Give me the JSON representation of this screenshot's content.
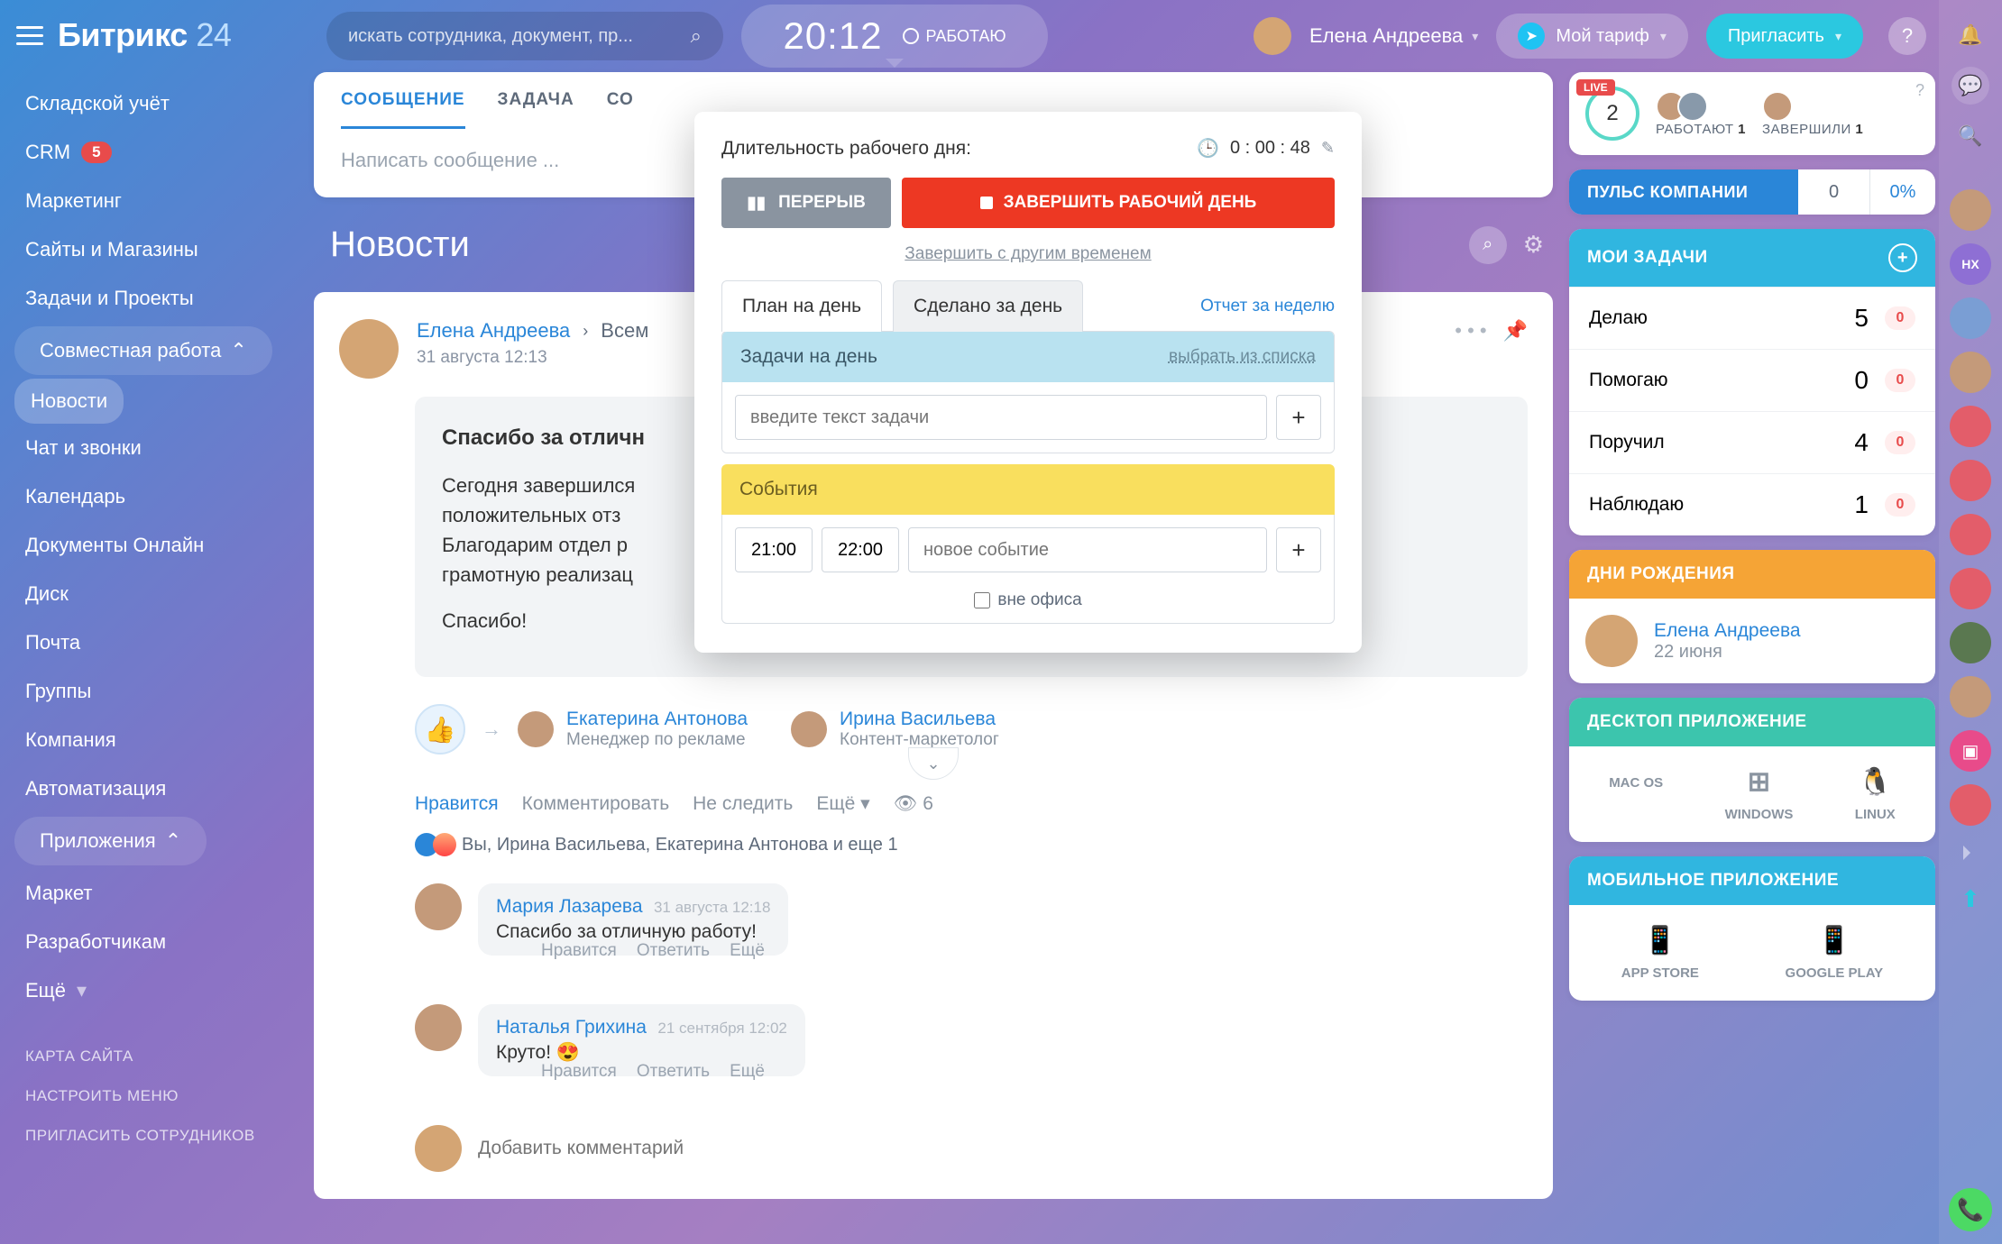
{
  "app": {
    "name": "Битрикс",
    "suffix": "24"
  },
  "topbar": {
    "search_placeholder": "искать сотрудника, документ, пр...",
    "clock": "20:12",
    "clock_status": "РАБОТАЮ",
    "user_name": "Елена Андреева",
    "tariff_label": "Мой тариф",
    "invite_label": "Пригласить",
    "help": "?"
  },
  "sidebar": {
    "items": [
      {
        "label": "Складской учёт"
      },
      {
        "label": "CRM",
        "badge": "5"
      },
      {
        "label": "Маркетинг"
      },
      {
        "label": "Сайты и Магазины"
      },
      {
        "label": "Задачи и Проекты"
      }
    ],
    "group_collab": "Совместная работа",
    "collab_items": [
      {
        "label": "Новости",
        "active": true
      },
      {
        "label": "Чат и звонки"
      },
      {
        "label": "Календарь"
      },
      {
        "label": "Документы Онлайн"
      },
      {
        "label": "Диск"
      },
      {
        "label": "Почта"
      },
      {
        "label": "Группы"
      }
    ],
    "items2": [
      {
        "label": "Компания"
      },
      {
        "label": "Автоматизация"
      }
    ],
    "group_apps": "Приложения",
    "app_items": [
      {
        "label": "Маркет"
      },
      {
        "label": "Разработчикам"
      }
    ],
    "more": "Ещё",
    "footer": [
      "КАРТА САЙТА",
      "НАСТРОИТЬ МЕНЮ",
      "ПРИГЛАСИТЬ СОТРУДНИКОВ"
    ]
  },
  "feed": {
    "tabs": [
      "СООБЩЕНИЕ",
      "ЗАДАЧА",
      "СО"
    ],
    "compose_placeholder": "Написать сообщение ...",
    "title": "Новости",
    "post": {
      "author": "Елена Андреева",
      "audience": "Всем",
      "date": "31 августа 12:13",
      "heading": "Спасибо за отличн",
      "p1": "Сегодня завершился",
      "p2": "положительных отз",
      "p3": "Благодарим отдел р",
      "p4": "грамотную реализац",
      "p5": "Спасибо!",
      "mentions": [
        {
          "name": "Екатерина Антонова",
          "role": "Менеджер по рекламе"
        },
        {
          "name": "Ирина Васильева",
          "role": "Контент-маркетолог"
        }
      ],
      "actions": {
        "like": "Нравится",
        "comment": "Комментировать",
        "unfollow": "Не следить",
        "more": "Ещё",
        "views": "6"
      },
      "reactions_text": "Вы, Ирина Васильева, Екатерина Антонова и еще 1",
      "comments": [
        {
          "author": "Мария Лазарева",
          "date": "31 августа 12:18",
          "text": "Спасибо за отличную работу!"
        },
        {
          "author": "Наталья Грихина",
          "date": "21 сентября 12:02",
          "text": "Круто! 😍"
        }
      ],
      "comment_actions": [
        "Нравится",
        "Ответить",
        "Ещё"
      ],
      "add_comment_placeholder": "Добавить комментарий"
    }
  },
  "popover": {
    "workday_label": "Длительность рабочего дня:",
    "timer": "0 : 00 : 48",
    "pause": "ПЕРЕРЫВ",
    "stop": "ЗАВЕРШИТЬ РАБОЧИЙ ДЕНЬ",
    "stop_link": "Завершить с другим временем",
    "tabs": [
      "План на день",
      "Сделано за день"
    ],
    "week_report": "Отчет за неделю",
    "tasks_header": "Задачи на день",
    "tasks_select": "выбрать из списка",
    "task_placeholder": "введите текст задачи",
    "events_header": "События",
    "time1": "21:00",
    "time2": "22:00",
    "event_placeholder": "новое событие",
    "out_of_office": "вне офиса"
  },
  "widgets": {
    "live": {
      "badge": "LIVE",
      "count": "2",
      "working": "РАБОТАЮТ",
      "working_n": "1",
      "done": "ЗАВЕРШИЛИ",
      "done_n": "1"
    },
    "pulse": {
      "label": "ПУЛЬС КОМПАНИИ",
      "v1": "0",
      "v2": "0%"
    },
    "tasks": {
      "header": "МОИ ЗАДАЧИ",
      "rows": [
        {
          "label": "Делаю",
          "count": "5",
          "badge": "0"
        },
        {
          "label": "Помогаю",
          "count": "0",
          "badge": "0"
        },
        {
          "label": "Поручил",
          "count": "4",
          "badge": "0"
        },
        {
          "label": "Наблюдаю",
          "count": "1",
          "badge": "0"
        }
      ]
    },
    "bday": {
      "header": "ДНИ РОЖДЕНИЯ",
      "name": "Елена Андреева",
      "date": "22 июня"
    },
    "desktop": {
      "header": "ДЕСКТОП ПРИЛОЖЕНИЕ",
      "platforms": [
        "MAC OS",
        "WINDOWS",
        "LINUX"
      ]
    },
    "mobile": {
      "header": "МОБИЛЬНОЕ ПРИЛОЖЕНИЕ",
      "platforms": [
        "APP STORE",
        "GOOGLE PLAY"
      ]
    }
  },
  "chatbar": {
    "hx": "НХ"
  }
}
